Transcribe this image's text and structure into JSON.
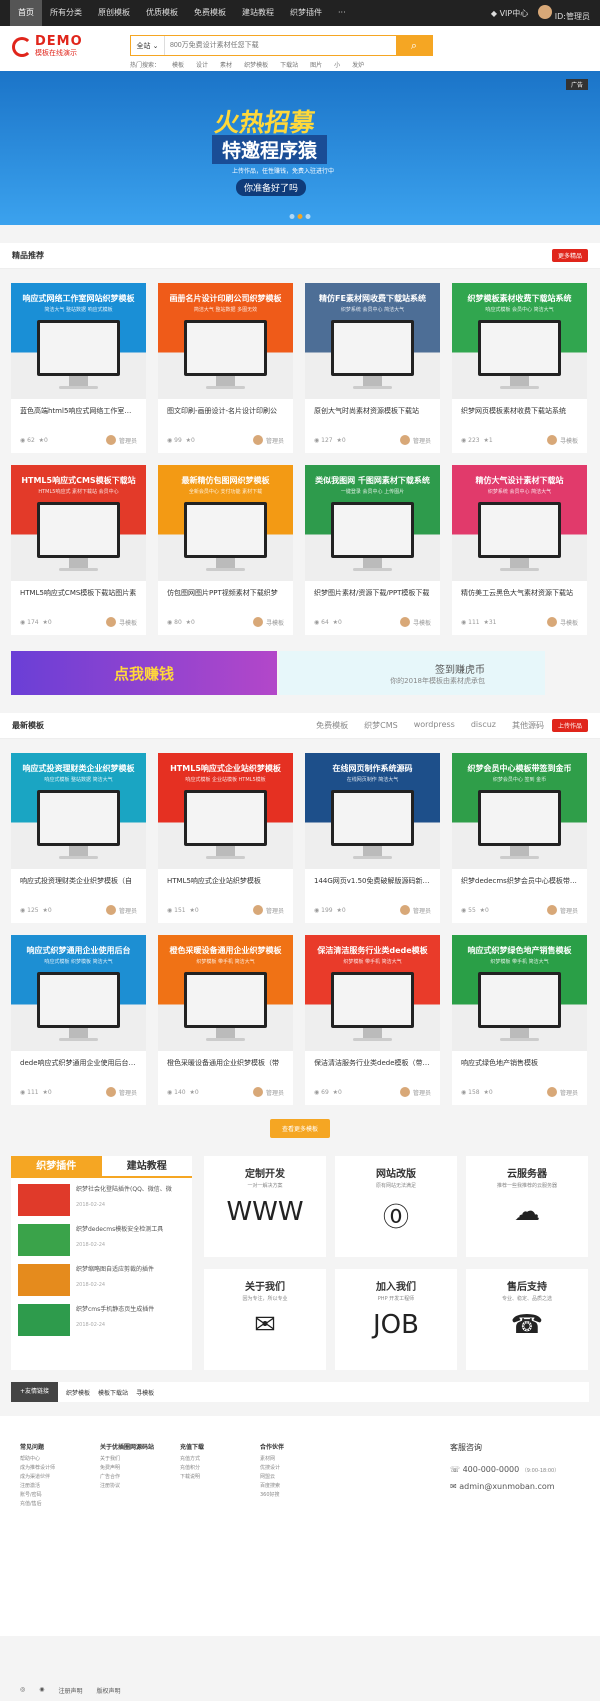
{
  "topbar": {
    "nav": [
      "首页",
      "所有分类",
      "原创模板",
      "优质模板",
      "免费模板",
      "建站教程",
      "织梦插件",
      "···"
    ],
    "vip": "VIP中心",
    "user": "ID:管理员"
  },
  "header": {
    "logo_title": "DEMO",
    "logo_sub": "模板在线演示",
    "search_select": "全站",
    "search_placeholder": "800万免费设计素材任您下载",
    "hot_label": "热门搜索：",
    "hot": [
      "模板",
      "设计",
      "素材",
      "织梦模板",
      "下载站",
      "图片",
      "小",
      "发炉"
    ]
  },
  "banner": {
    "ad": "广告",
    "line1": "火热招募",
    "line2": "特邀程序猿",
    "line3": "上传作品，任性赚钱，免费入驻进行中",
    "line4": "你准备好了吗"
  },
  "featured": {
    "title": "精品推荐",
    "more": "更多精品",
    "cards": [
      {
        "thumb_title": "响应式网络工作室网站织梦模板",
        "thumb_sub": "简洁大气 整站数据 响应式模板",
        "title": "蓝色高端html5响应式网络工作室网站",
        "views": "62",
        "likes": "0",
        "author": "管理员",
        "color": "#1a8fd6"
      },
      {
        "thumb_title": "画册名片设计印刷公司织梦模板",
        "thumb_sub": "简洁大气 整站数据 多图无效",
        "title": "图文印刷-画册设计-名片设计印刷公",
        "views": "99",
        "likes": "0",
        "author": "管理员",
        "color": "#ef5b19"
      },
      {
        "thumb_title": "精仿FE素材网收费下载站系统",
        "thumb_sub": "织梦系统 会员中心 简洁大气",
        "title": "原创大气时尚素材资源模板下载站",
        "views": "127",
        "likes": "0",
        "author": "管理员",
        "color": "#4d6e96"
      },
      {
        "thumb_title": "织梦模板素材收费下载站系统",
        "thumb_sub": "响应式模板 会员中心 简洁大气",
        "title": "织梦网页模板素材收费下载站系统",
        "views": "223",
        "likes": "1",
        "author": "寻模板",
        "color": "#31a64f"
      },
      {
        "thumb_title": "HTML5响应式CMS模板下载站",
        "thumb_sub": "HTML5响应式 素材下载站 会员中心",
        "title": "HTML5响应式CMS模板下载站图片素",
        "views": "174",
        "likes": "0",
        "author": "寻模板",
        "color": "#e33a29"
      },
      {
        "thumb_title": "最新精仿包图网织梦模板",
        "thumb_sub": "全新会员中心 支付功能 素材下载",
        "title": "仿包图网图片PPT视频素材下载织梦",
        "views": "80",
        "likes": "0",
        "author": "寻模板",
        "color": "#f39a14"
      },
      {
        "thumb_title": "类似我图网  千图网素材下载系统",
        "thumb_sub": "一键登录 会员中心 上传图片",
        "title": "织梦图片素材/资源下载/PPT模板下载",
        "views": "64",
        "likes": "0",
        "author": "寻模板",
        "color": "#2e9b4c"
      },
      {
        "thumb_title": "精仿大气设计素材下载站",
        "thumb_sub": "织梦系统 会员中心 简洁大气",
        "title": "精仿美工云黑色大气素材资源下载站",
        "views": "111",
        "likes": "31",
        "author": "寻模板",
        "color": "#e13a6b"
      }
    ]
  },
  "promo": {
    "left": "点我赚钱",
    "right_title": "签到赚虎币",
    "right_sub": "你的2018年模板由素材虎承包"
  },
  "latest": {
    "title": "最新模板",
    "tabs": [
      "免费模板",
      "织梦CMS",
      "wordpress",
      "discuz",
      "其他源码"
    ],
    "more": "上传作品",
    "cards": [
      {
        "thumb_title": "响应式投资理财类企业织梦模板",
        "thumb_sub": "响应式模板 整站数据 简洁大气",
        "title": "响应式投资理财类企业织梦模板（自",
        "views": "125",
        "likes": "0",
        "author": "管理员",
        "color": "#1aa5c3"
      },
      {
        "thumb_title": "HTML5响应式企业站织梦模板",
        "thumb_sub": "响应式模板 企业站模板 HTML5模板",
        "title": "HTML5响应式企业站织梦模板",
        "views": "151",
        "likes": "0",
        "author": "管理员",
        "color": "#e53022"
      },
      {
        "thumb_title": "在线网页制作系统源码",
        "thumb_sub": "在线网页制作 简洁大气",
        "title": "144G网页v1.50免费破解版源码新版-",
        "views": "199",
        "likes": "0",
        "author": "管理员",
        "color": "#1d4f8a"
      },
      {
        "thumb_title": "织梦会员中心模板带签到金币",
        "thumb_sub": "织梦会员中心 签到 金币",
        "title": "织梦dedecms织梦会员中心模板带签到",
        "views": "55",
        "likes": "0",
        "author": "管理员",
        "color": "#2f9e49"
      },
      {
        "thumb_title": "响应式织梦通用企业使用后台",
        "thumb_sub": "响应式模板 织梦模板 简洁大气",
        "title": "dede响应式织梦通用企业使用后台（自",
        "views": "111",
        "likes": "0",
        "author": "管理员",
        "color": "#1d8fd3"
      },
      {
        "thumb_title": "橙色采暖设备通用企业织梦模板",
        "thumb_sub": "织梦模板 带手机 简洁大气",
        "title": "橙色采暖设备通用企业织梦模板（带",
        "views": "140",
        "likes": "0",
        "author": "管理员",
        "color": "#f07215"
      },
      {
        "thumb_title": "保洁清洁服务行业类dede模板",
        "thumb_sub": "织梦模板 带手机 简洁大气",
        "title": "保洁清洁服务行业类dede模板（带手机",
        "views": "69",
        "likes": "0",
        "author": "管理员",
        "color": "#e93b2a"
      },
      {
        "thumb_title": "响应式织梦绿色地产销售模板",
        "thumb_sub": "织梦模板 带手机 简洁大气",
        "title": "响应式绿色地产销售模板",
        "views": "158",
        "likes": "0",
        "author": "管理员",
        "color": "#2a9f47"
      }
    ]
  },
  "loadmore": "查看更多模板",
  "news": {
    "tabs": [
      "织梦插件",
      "建站教程"
    ],
    "items": [
      {
        "title": "织梦社会化登陆插件(QQ、微信、微",
        "date": "2018-02-24",
        "color": "#e03a2a"
      },
      {
        "title": "织梦dedecms模板安全检测工具",
        "date": "2018-02-24",
        "color": "#3aa34a"
      },
      {
        "title": "织梦缩略图自适应剪裁的插件",
        "date": "2018-02-24",
        "color": "#e58b1d"
      },
      {
        "title": "织梦cms手机静态页生成插件",
        "date": "2018-02-24",
        "color": "#2e9b4c"
      }
    ]
  },
  "services": [
    {
      "title": "定制开发",
      "sub": "一对一解决方案",
      "icon": "WWW"
    },
    {
      "title": "网站改版",
      "sub": "原有网站无法满足",
      "icon": "⓪"
    },
    {
      "title": "云服务器",
      "sub": "推荐一些我推荐的云服务器",
      "icon": "☁"
    },
    {
      "title": "关于我们",
      "sub": "因为专注，所以专业",
      "icon": "✉"
    },
    {
      "title": "加入我们",
      "sub": "PHP 开发工程师",
      "icon": "JOB"
    },
    {
      "title": "售后支持",
      "sub": "专业、稳定、品质之选",
      "icon": "☎"
    }
  ],
  "links": {
    "label": "+友情链接",
    "items": [
      "织梦模板",
      "模板下载站",
      "寻模板"
    ]
  },
  "footer": {
    "cols": [
      {
        "title": "常见问题",
        "items": [
          "帮助中心",
          "成为推荐设计师",
          "成为渠道伙伴",
          "注册激活",
          "账号/密码",
          "充值/售后"
        ]
      },
      {
        "title": "关于优插圈网源码站",
        "items": [
          "关于我们",
          "免费声明",
          "广告合作",
          "注册协议"
        ]
      },
      {
        "title": "充值下载",
        "items": [
          "充值方式",
          "充值积分",
          "下载说明"
        ]
      },
      {
        "title": "合作伙伴",
        "items": [
          "素材网",
          "优搜设计",
          "网盟云",
          "百度搜索",
          "360好搜"
        ]
      }
    ],
    "contact_title": "客服咨询",
    "phone": "400-000-0000",
    "hours": "（9:00-18:00）",
    "email": "admin@xunmoban.com"
  },
  "copyright": [
    "注册声明",
    "版权声明"
  ]
}
